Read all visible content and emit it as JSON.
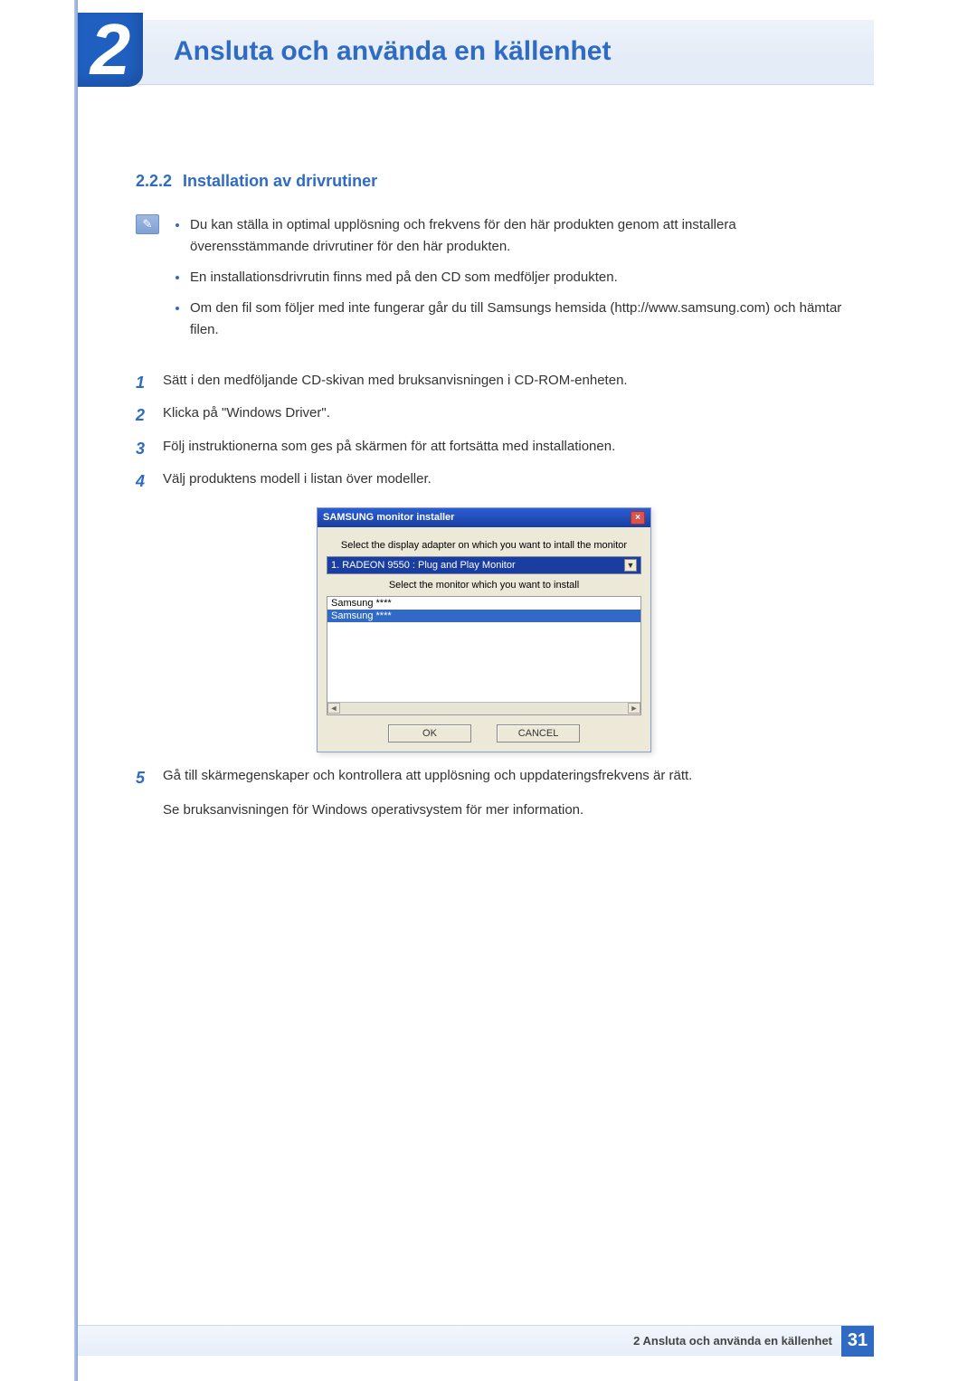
{
  "chapter": {
    "number": "2",
    "title": "Ansluta och använda en källenhet"
  },
  "section": {
    "number": "2.2.2",
    "title": "Installation av drivrutiner"
  },
  "notes": [
    "Du kan ställa in optimal upplösning och frekvens för den här produkten genom att installera överensstämmande drivrutiner för den här produkten.",
    "En installationsdrivrutin finns med på den CD som medföljer produkten.",
    "Om den fil som följer med inte fungerar går du till Samsungs hemsida (http://www.samsung.com) och hämtar filen."
  ],
  "steps": {
    "1": "Sätt i den medföljande CD-skivan med bruksanvisningen i CD-ROM-enheten.",
    "2": "Klicka på \"Windows Driver\".",
    "3": "Följ instruktionerna som ges på skärmen för att fortsätta med installationen.",
    "4": "Välj produktens modell i listan över modeller.",
    "5": "Gå till skärmegenskaper och kontrollera att upplösning och uppdateringsfrekvens är rätt.",
    "5_extra": "Se bruksanvisningen för Windows operativsystem för mer information."
  },
  "installer": {
    "title": "SAMSUNG monitor installer",
    "label_adapter": "Select the display adapter on which you want to intall the monitor",
    "adapter_selected": "1. RADEON 9550 : Plug and Play Monitor",
    "label_monitor": "Select the monitor which you want to install",
    "monitors": [
      "Samsung ****",
      "Samsung ****"
    ],
    "btn_ok": "OK",
    "btn_cancel": "CANCEL"
  },
  "footer": {
    "text": "2 Ansluta och använda en källenhet",
    "page": "31"
  }
}
